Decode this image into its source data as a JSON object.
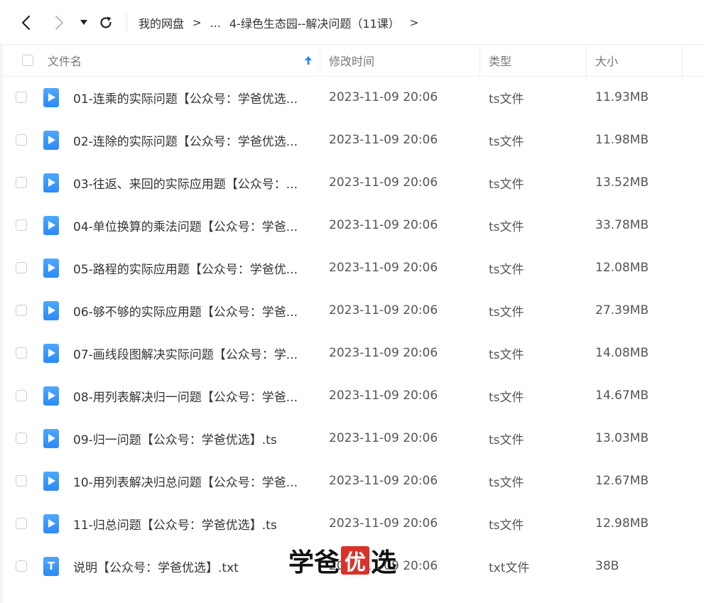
{
  "nav": {
    "back_icon": "chevron-left-icon",
    "forward_icon": "chevron-right-icon",
    "dropdown_icon": "caret-down-icon",
    "refresh_icon": "refresh-icon"
  },
  "breadcrumb": {
    "root": "我的网盘",
    "separator": ">",
    "ellipsis": "...",
    "current": "4-绿色生态园--解决问题（11课）",
    "tail": ">"
  },
  "table": {
    "headers": {
      "name": "文件名",
      "modified": "修改时间",
      "type": "类型",
      "size": "大小"
    },
    "sort_icon": "arrow-up-icon",
    "rows": [
      {
        "name": "01-连乘的实际问题【公众号：学爸优选...",
        "modified": "2023-11-09 20:06",
        "type": "ts文件",
        "size": "11.93MB",
        "icon": "video-file-icon"
      },
      {
        "name": "02-连除的实际问题【公众号：学爸优选...",
        "modified": "2023-11-09 20:06",
        "type": "ts文件",
        "size": "11.98MB",
        "icon": "video-file-icon"
      },
      {
        "name": "03-往返、来回的实际应用题【公众号：...",
        "modified": "2023-11-09 20:06",
        "type": "ts文件",
        "size": "13.52MB",
        "icon": "video-file-icon"
      },
      {
        "name": "04-单位换算的乘法问题【公众号：学爸...",
        "modified": "2023-11-09 20:06",
        "type": "ts文件",
        "size": "33.78MB",
        "icon": "video-file-icon"
      },
      {
        "name": "05-路程的实际应用题【公众号：学爸优...",
        "modified": "2023-11-09 20:06",
        "type": "ts文件",
        "size": "12.08MB",
        "icon": "video-file-icon"
      },
      {
        "name": "06-够不够的实际应用题【公众号：学爸...",
        "modified": "2023-11-09 20:06",
        "type": "ts文件",
        "size": "27.39MB",
        "icon": "video-file-icon"
      },
      {
        "name": "07-画线段图解决实际问题【公众号：学...",
        "modified": "2023-11-09 20:06",
        "type": "ts文件",
        "size": "14.08MB",
        "icon": "video-file-icon"
      },
      {
        "name": "08-用列表解决归一问题【公众号：学爸...",
        "modified": "2023-11-09 20:06",
        "type": "ts文件",
        "size": "14.67MB",
        "icon": "video-file-icon"
      },
      {
        "name": "09-归一问题【公众号：学爸优选】.ts",
        "modified": "2023-11-09 20:06",
        "type": "ts文件",
        "size": "13.03MB",
        "icon": "video-file-icon"
      },
      {
        "name": "10-用列表解决归总问题【公众号：学爸...",
        "modified": "2023-11-09 20:06",
        "type": "ts文件",
        "size": "12.67MB",
        "icon": "video-file-icon"
      },
      {
        "name": "11-归总问题【公众号：学爸优选】.ts",
        "modified": "2023-11-09 20:06",
        "type": "ts文件",
        "size": "12.98MB",
        "icon": "video-file-icon"
      },
      {
        "name": "说明【公众号：学爸优选】.txt",
        "modified": "2023-11-09 20:06",
        "type": "txt文件",
        "size": "38B",
        "icon": "text-file-icon"
      }
    ]
  },
  "watermark": {
    "part1": "学爸",
    "seal": "优",
    "part2": "选"
  }
}
